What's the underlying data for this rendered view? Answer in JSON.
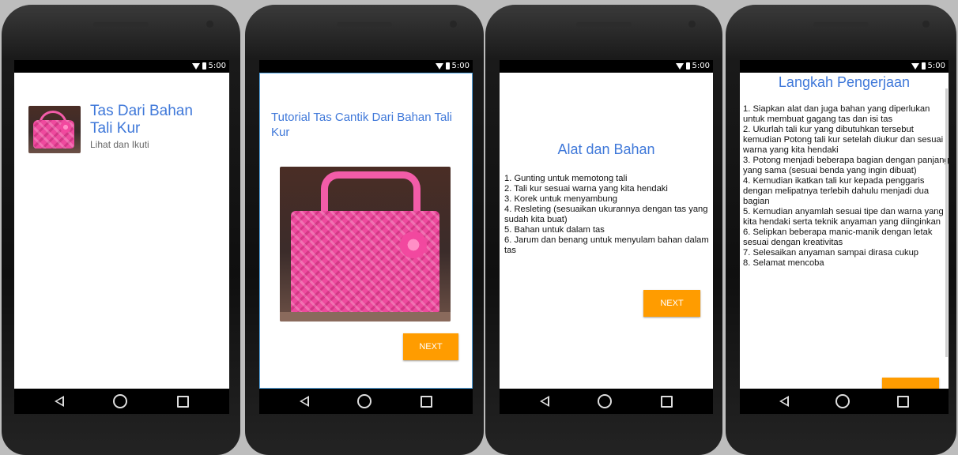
{
  "status": {
    "time": "5:00"
  },
  "screen1": {
    "title": "Tas Dari Bahan Tali Kur",
    "subtitle": "Lihat dan Ikuti"
  },
  "screen2": {
    "title": "Tutorial Tas Cantik Dari Bahan Tali Kur",
    "next_label": "NEXT"
  },
  "screen3": {
    "title": "Alat dan Bahan",
    "items": [
      "1. Gunting untuk memotong tali",
      "2. Tali kur sesuai warna yang kita hendaki",
      "3. Korek untuk menyambung",
      "4. Resleting (sesuaikan ukurannya dengan tas yang sudah kita buat)",
      "5. Bahan untuk dalam tas",
      "6. Jarum dan benang untuk menyulam bahan dalam tas"
    ],
    "next_label": "NEXT"
  },
  "screen4": {
    "title": "Langkah Pengerjaan",
    "steps": [
      "1. Siapkan alat dan juga bahan yang diperlukan untuk membuat gagang tas dan isi tas",
      "2. Ukurlah tali kur yang dibutuhkan tersebut kemudian Potong tali kur setelah diukur dan sesuai warna yang kita hendaki",
      "3. Potong menjadi beberapa bagian dengan panjang yang sama (sesuai benda yang ingin dibuat)",
      "4. Kemudian ikatkan tali kur kepada penggaris dengan melipatnya terlebih dahulu menjadi dua bagian",
      "5. Kemudian anyamlah sesuai tipe dan warna yang kita hendaki serta teknik anyaman yang diinginkan",
      "6. Selipkan beberapa manic-manik dengan letak sesuai dengan kreativitas",
      "7. Selesaikan anyaman sampai dirasa cukup",
      "8. Selamat mencoba"
    ]
  }
}
